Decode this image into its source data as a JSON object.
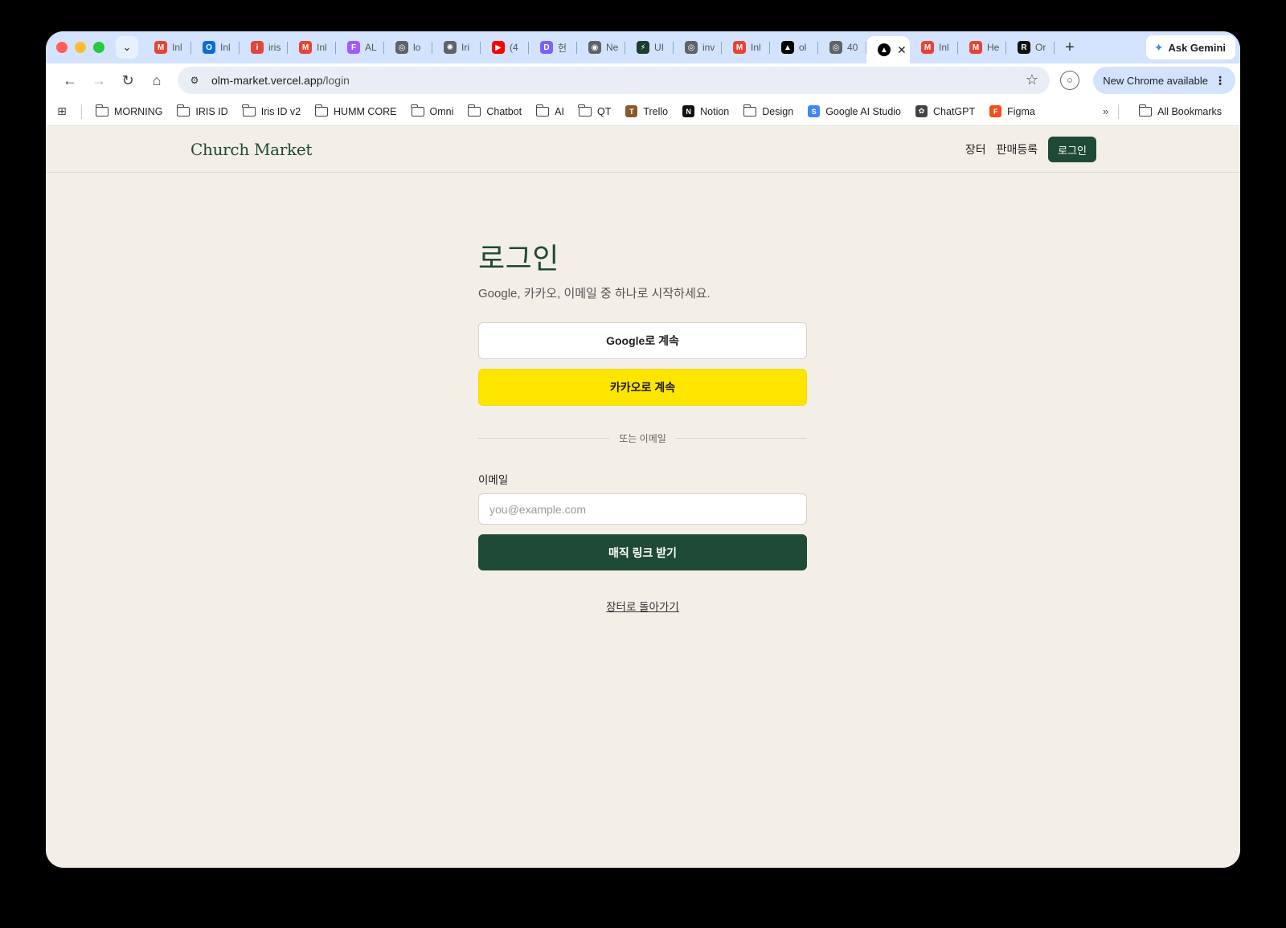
{
  "browser": {
    "tabs": [
      {
        "title": "Inl",
        "icon": "gmail-icon",
        "glyph": "M",
        "color": "#ea4335"
      },
      {
        "title": "Inl",
        "icon": "outlook-icon",
        "glyph": "O",
        "color": "#0a6ed1"
      },
      {
        "title": "iris",
        "icon": "iris-icon",
        "glyph": "i",
        "color": "#e2473b"
      },
      {
        "title": "Inl",
        "icon": "gmail-icon",
        "glyph": "M",
        "color": "#ea4335"
      },
      {
        "title": "AL",
        "icon": "figma-icon",
        "glyph": "F",
        "color": "#a259ff"
      },
      {
        "title": "lo",
        "icon": "globe-icon",
        "glyph": "◎",
        "color": "#5f6368"
      },
      {
        "title": "Iri",
        "icon": "aperture-icon",
        "glyph": "✺",
        "color": "#5f6368"
      },
      {
        "title": "(4",
        "icon": "youtube-icon",
        "glyph": "▶",
        "color": "#ff0000"
      },
      {
        "title": "헌",
        "icon": "d-app-icon",
        "glyph": "D",
        "color": "#7b61ff"
      },
      {
        "title": "Ne",
        "icon": "chrome-icon",
        "glyph": "◉",
        "color": "#5f6368"
      },
      {
        "title": "UI",
        "icon": "bolt-icon",
        "glyph": "⚡",
        "color": "#1c3d2f"
      },
      {
        "title": "inv",
        "icon": "globe-icon",
        "glyph": "◎",
        "color": "#5f6368"
      },
      {
        "title": "Inl",
        "icon": "gmail-icon",
        "glyph": "M",
        "color": "#ea4335"
      },
      {
        "title": "ol",
        "icon": "vercel-icon",
        "glyph": "▲",
        "color": "#000000"
      },
      {
        "title": "40",
        "icon": "globe-icon",
        "glyph": "◎",
        "color": "#5f6368"
      }
    ],
    "active_tab": {
      "icon": "vercel-icon",
      "glyph": "▲",
      "color": "#000000",
      "close": "✕"
    },
    "tabs_after": [
      {
        "title": "Inl",
        "icon": "gmail-icon",
        "glyph": "M",
        "color": "#ea4335"
      },
      {
        "title": "He",
        "icon": "gmail-icon",
        "glyph": "M",
        "color": "#ea4335"
      },
      {
        "title": "Or",
        "icon": "r-app-icon",
        "glyph": "R",
        "color": "#111111"
      }
    ],
    "new_tab": "+",
    "gemini_label": "Ask Gemini",
    "url_host": "olm-market.vercel.app",
    "url_path": "/login",
    "update_label": "New Chrome available",
    "bookmarks": [
      {
        "label": "MORNING",
        "type": "folder"
      },
      {
        "label": "IRIS ID",
        "type": "folder"
      },
      {
        "label": "Iris ID v2",
        "type": "folder"
      },
      {
        "label": "HUMM CORE",
        "type": "folder"
      },
      {
        "label": "Omni",
        "type": "folder"
      },
      {
        "label": "Chatbot",
        "type": "folder"
      },
      {
        "label": "AI",
        "type": "folder"
      },
      {
        "label": "QT",
        "type": "folder"
      },
      {
        "label": "Trello",
        "type": "site",
        "glyph": "T",
        "color": "#8b5a2b"
      },
      {
        "label": "Notion",
        "type": "site",
        "glyph": "N",
        "color": "#111111"
      },
      {
        "label": "Design",
        "type": "folder"
      },
      {
        "label": "Google AI Studio",
        "type": "site",
        "glyph": "S",
        "color": "#4285f4"
      },
      {
        "label": "ChatGPT",
        "type": "site",
        "glyph": "✿",
        "color": "#444444"
      },
      {
        "label": "Figma",
        "type": "site",
        "glyph": "F",
        "color": "#f24e1e"
      }
    ],
    "bookmarks_more": "»",
    "all_bookmarks": "All Bookmarks"
  },
  "site": {
    "brand": "Church Market",
    "nav": {
      "market": "장터",
      "sell": "판매등록",
      "login": "로그인"
    },
    "accent": "#1f4a35"
  },
  "login": {
    "title": "로그인",
    "subtitle": "Google, 카카오, 이메일 중 하나로 시작하세요.",
    "google_btn": "Google로 계속",
    "kakao_btn": "카카오로 계속",
    "divider": "또는 이메일",
    "email_label": "이메일",
    "email_placeholder": "you@example.com",
    "email_value": "",
    "magic_btn": "매직 링크 받기",
    "back_link": "장터로 돌아가기",
    "kakao_color": "#fee500"
  }
}
